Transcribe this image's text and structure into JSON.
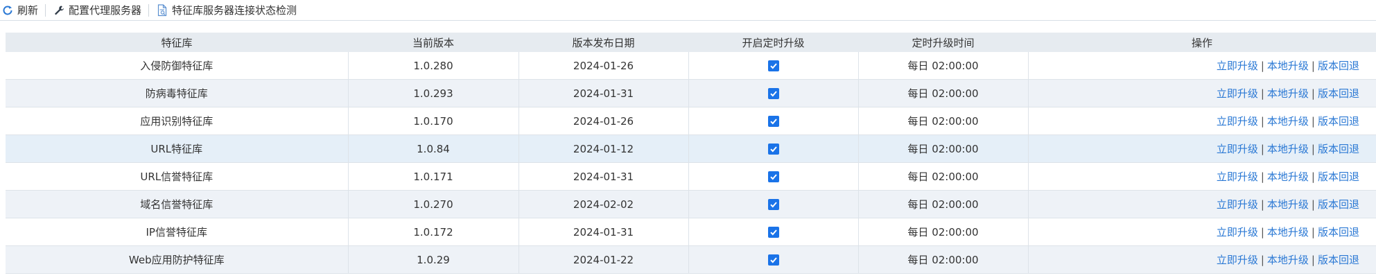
{
  "toolbar": {
    "refresh": {
      "label": "刷新",
      "icon": "refresh-icon"
    },
    "proxy": {
      "label": "配置代理服务器",
      "icon": "wrench-icon"
    },
    "check": {
      "label": "特征库服务器连接状态检测",
      "icon": "document-check-icon"
    }
  },
  "table": {
    "headers": [
      "特征库",
      "当前版本",
      "版本发布日期",
      "开启定时升级",
      "定时升级时间",
      "操作"
    ],
    "action_labels": {
      "upgrade_now": "立即升级",
      "local_upgrade": "本地升级",
      "rollback": "版本回退",
      "separator": "|"
    },
    "rows": [
      {
        "name": "入侵防御特征库",
        "version": "1.0.280",
        "date": "2024-01-26",
        "scheduled": true,
        "time": "每日 02:00:00"
      },
      {
        "name": "防病毒特征库",
        "version": "1.0.293",
        "date": "2024-01-31",
        "scheduled": true,
        "time": "每日 02:00:00"
      },
      {
        "name": "应用识别特征库",
        "version": "1.0.170",
        "date": "2024-01-26",
        "scheduled": true,
        "time": "每日 02:00:00"
      },
      {
        "name": "URL特征库",
        "version": "1.0.84",
        "date": "2024-01-12",
        "scheduled": true,
        "time": "每日 02:00:00"
      },
      {
        "name": "URL信誉特征库",
        "version": "1.0.171",
        "date": "2024-01-31",
        "scheduled": true,
        "time": "每日 02:00:00"
      },
      {
        "name": "域名信誉特征库",
        "version": "1.0.270",
        "date": "2024-02-02",
        "scheduled": true,
        "time": "每日 02:00:00"
      },
      {
        "name": "IP信誉特征库",
        "version": "1.0.172",
        "date": "2024-01-31",
        "scheduled": true,
        "time": "每日 02:00:00"
      },
      {
        "name": "Web应用防护特征库",
        "version": "1.0.29",
        "date": "2024-01-22",
        "scheduled": true,
        "time": "每日 02:00:00"
      }
    ]
  },
  "colors": {
    "accent": "#1a73e8",
    "link": "#2a78d4",
    "header_bg": "#e6ebf0",
    "row_alt_bg": "#eef2f7",
    "row_hover_bg": "#e5eff8"
  }
}
